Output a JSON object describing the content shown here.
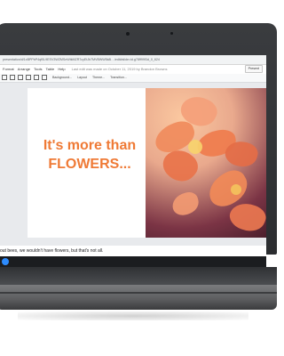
{
  "browser": {
    "url": "presentation/d/1xBPPbP4qf0L9ESV3WZMSeWtkMZR7cyEtJb7MVBWW5k8l…/edit#slide=id.g78ff99f3d_0_624"
  },
  "menu": {
    "items": [
      "Format",
      "Arrange",
      "Tools",
      "Table",
      "Help"
    ],
    "last_edit": "Last edit was made on October 11, 2019 by Brandon Browns",
    "present_label": "Present"
  },
  "toolbar": {
    "buttons": [
      "Background...",
      "Layout",
      "Theme...",
      "Transition..."
    ]
  },
  "slide": {
    "line1": "It's more than",
    "line2": "FLOWERS...",
    "accent_color": "#ef7a36"
  },
  "notes": {
    "text": "out bees, we wouldn't have flowers, but that's not all."
  },
  "icons": {
    "launcher": "launcher-icon",
    "camera": "camera-icon"
  }
}
